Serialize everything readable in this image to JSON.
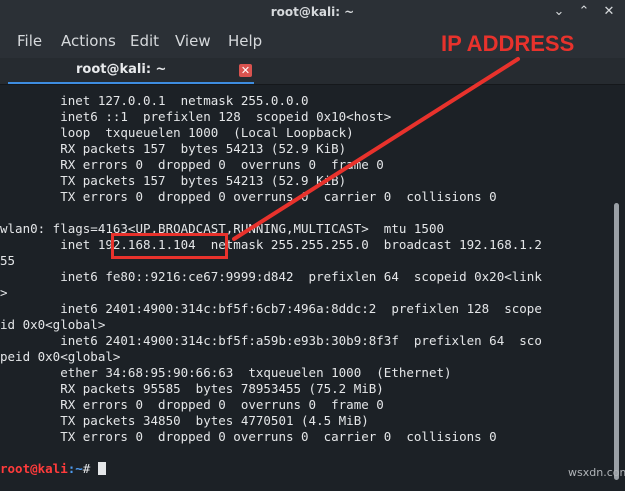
{
  "window": {
    "title": "root@kali: ~"
  },
  "menu": [
    "File",
    "Actions",
    "Edit",
    "View",
    "Help"
  ],
  "tab": {
    "label": "root@kali: ~",
    "close": "✕"
  },
  "terminal": {
    "lines": [
      "        inet 127.0.0.1  netmask 255.0.0.0",
      "        inet6 ::1  prefixlen 128  scopeid 0x10<host>",
      "        loop  txqueuelen 1000  (Local Loopback)",
      "        RX packets 157  bytes 54213 (52.9 KiB)",
      "        RX errors 0  dropped 0  overruns 0  frame 0",
      "        TX packets 157  bytes 54213 (52.9 KiB)",
      "        TX errors 0  dropped 0 overruns 0  carrier 0  collisions 0",
      "",
      "wlan0: flags=4163<UP,BROADCAST,RUNNING,MULTICAST>  mtu 1500",
      "        inet 192.168.1.104  netmask 255.255.255.0  broadcast 192.168.1.2",
      "55",
      "        inet6 fe80::9216:ce67:9999:d842  prefixlen 64  scopeid 0x20<link",
      ">",
      "        inet6 2401:4900:314c:bf5f:6cb7:496a:8ddc:2  prefixlen 128  scope",
      "id 0x0<global>",
      "        inet6 2401:4900:314c:bf5f:a59b:e93b:30b9:8f3f  prefixlen 64  sco",
      "peid 0x0<global>",
      "        ether 34:68:95:90:66:63  txqueuelen 1000  (Ethernet)",
      "        RX packets 95585  bytes 78953455 (75.2 MiB)",
      "        RX errors 0  dropped 0  overruns 0  frame 0",
      "        TX packets 34850  bytes 4770501 (4.5 MiB)",
      "        TX errors 0  dropped 0 overruns 0  carrier 0  collisions 0",
      ""
    ],
    "prompt_user": "root@kali",
    "prompt_path": ":~",
    "prompt_symbol": "# "
  },
  "annotation": {
    "label": "IP ADDRESS",
    "color": "#e8322c"
  },
  "watermark": "wsxdn.com",
  "icons": {
    "minimize": "minimize-icon",
    "maximize": "maximize-icon",
    "close": "close-icon"
  }
}
